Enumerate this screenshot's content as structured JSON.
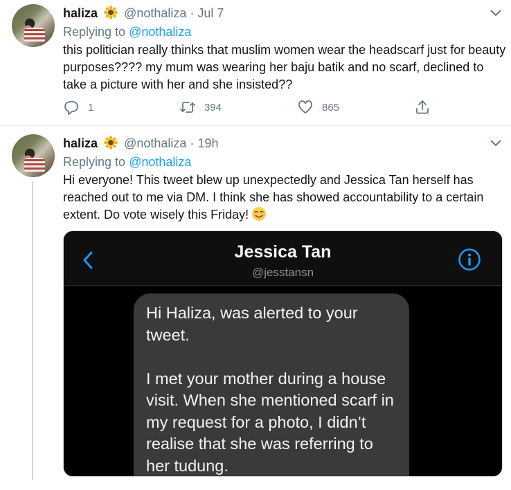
{
  "tweets": [
    {
      "name": "haliza",
      "handle": "@nothaliza",
      "separator": "·",
      "time": "Jul 7",
      "replying_prefix": "Replying to",
      "replying_to": "@nothaliza",
      "text": "this politician really thinks that muslim women wear the headscarf just for beauty purposes???? my mum was wearing her baju batik and no scarf, declined to take a picture with her and she insisted??",
      "stats": {
        "replies": "1",
        "retweets": "394",
        "likes": "865"
      }
    },
    {
      "name": "haliza",
      "handle": "@nothaliza",
      "separator": "·",
      "time": "19h",
      "replying_prefix": "Replying to",
      "replying_to": "@nothaliza",
      "text": "Hi everyone! This tweet blew up unexpectedly and Jessica Tan herself has reached out to me via DM. I think she has showed accountability to a certain extent. Do vote wisely this Friday!",
      "media": {
        "dm_name": "Jessica Tan",
        "dm_handle": "@jesstansn",
        "message": "Hi Haliza, was alerted to your tweet.\n\nI met your mother during a house visit. When she mentioned scarf in my request for a photo, I didn’t realise that she was referring to her tudung."
      }
    }
  ],
  "icons": {
    "verified_emoji": "sunflower-icon",
    "menu": "chevron-down-icon",
    "reply": "reply-icon",
    "retweet": "retweet-icon",
    "like": "heart-icon",
    "share": "share-icon",
    "emoji": "smiling-face-icon",
    "dm_back": "back-chevron-icon",
    "dm_info": "info-icon"
  },
  "colors": {
    "link": "#1da1f2",
    "muted": "#657786",
    "text": "#14171a"
  }
}
